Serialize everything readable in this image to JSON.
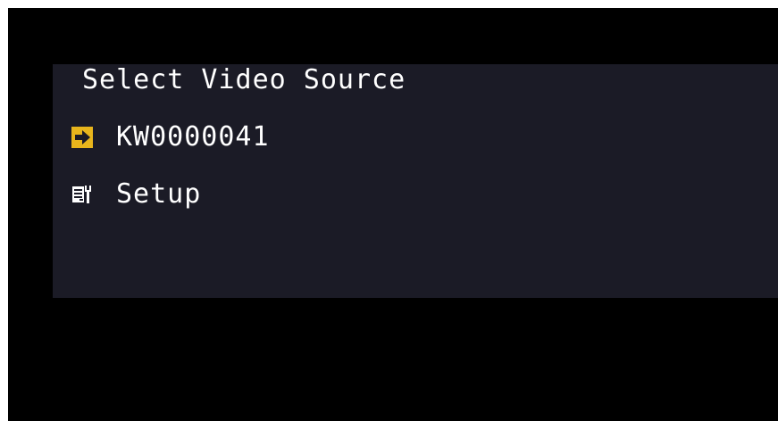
{
  "menu": {
    "title": "Select Video Source",
    "items": [
      {
        "label": "KW0000041",
        "icon": "arrow-right-icon",
        "selected": true
      },
      {
        "label": "Setup",
        "icon": "setup-tools-icon",
        "selected": false
      }
    ]
  },
  "colors": {
    "screen_background": "#000000",
    "panel_background": "#1b1b26",
    "text": "#ffffff",
    "selection_arrow": "#e8b51c"
  }
}
